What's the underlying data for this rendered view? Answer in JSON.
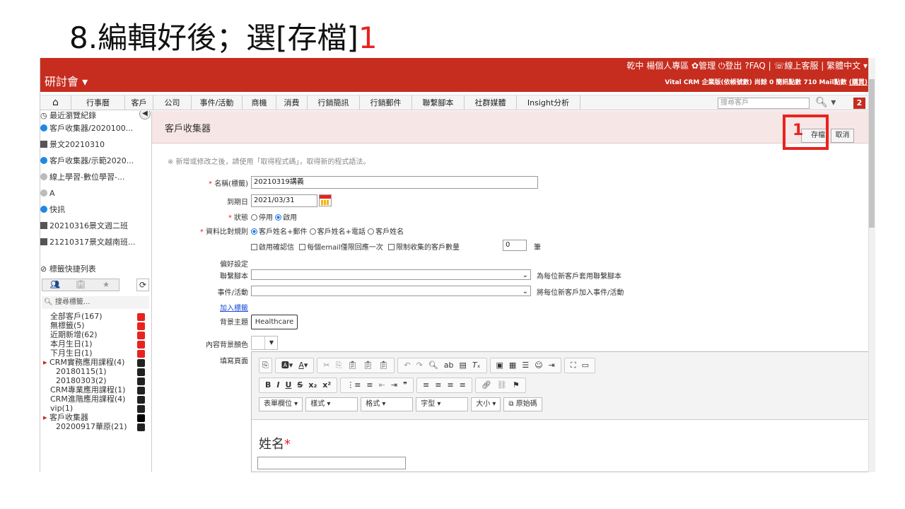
{
  "slide": {
    "title_text": "8.編輯好後；選[存檔]",
    "title_num": "1"
  },
  "topbar": {
    "brand": "研討會 ▾",
    "links": "乾中 楊個人專區  ✿管理  ⏻登出  ?FAQ  |  ☏線上客服  |  繁體中文 ▾",
    "info_prefix": "Vital CRM 企業版(依帳號數)  尚餘 0 簡訊點數 710 Mail點數 ",
    "info_link": "(購買)"
  },
  "nav": {
    "tabs": [
      "行事曆",
      "客戶",
      "公司",
      "事件/活動",
      "商機",
      "消費",
      "行銷簡訊",
      "行銷郵件",
      "聯繫腳本",
      "社群媒體",
      "Insight分析"
    ],
    "search_placeholder": "搜尋客戶",
    "badge": "2"
  },
  "sidebar": {
    "recent_title": "最近瀏覽紀錄",
    "recent": [
      "客戶收集器/2020100...",
      "景文20210310",
      "客戶收集器/示範2020...",
      "線上學習-數位學習-...",
      "A",
      "快訊",
      "20210316景文週二班",
      "21210317景文越南班..."
    ],
    "tags_title": "標籤快捷列表",
    "search_tags": "搜尋標籤...",
    "tags": [
      "全部客戶(167)",
      "無標籤(5)",
      "近期新增(62)",
      "本月生日(1)",
      "下月生日(1)",
      "CRM實務應用課程(4)",
      "20180115(1)",
      "20180303(2)",
      "CRM專業應用課程(1)",
      "CRM進階應用課程(4)",
      "vip(1)",
      "客戶收集器",
      "20200917華原(21)"
    ]
  },
  "main": {
    "title": "客戶收集器",
    "save": "存檔",
    "cancel": "取消",
    "highlight_num": "1",
    "note": "※ 新增或修改之後，請使用「取得程式碼」，取得新的程式語法。",
    "name_label": "名稱(標籤)",
    "name_value": "20210319講義",
    "due_label": "到期日",
    "due_value": "2021/03/31",
    "status_label": "狀態",
    "status_off": "停用",
    "status_on": "啟用",
    "rule_label": "資料比對規則",
    "rule_opts": [
      "客戶姓名+郵件",
      "客戶姓名+電話",
      "客戶姓名"
    ],
    "confirm_mail": "啟用確認信",
    "email_once": "每個email僅限回應一次",
    "limit_count": "限制收集的客戶數量",
    "limit_value": "0",
    "limit_unit": "筆",
    "pref_label": "偏好設定",
    "script_label": "聯繫腳本",
    "script_hint": "為每位新客戶套用聯繫腳本",
    "event_label": "事件/活動",
    "event_hint": "將每位新客戶加入事件/活動",
    "add_tag": "加入標籤",
    "theme_label": "背景主題",
    "theme_value": "Healthcare",
    "bgcolor_label": "內容背景顏色",
    "fill_label": "填寫頁面",
    "dd_form": "表單欄位",
    "dd_style": "樣式",
    "dd_format": "格式",
    "dd_font": "字型",
    "dd_size": "大小",
    "source": "原始碼",
    "body_name": "姓名"
  }
}
